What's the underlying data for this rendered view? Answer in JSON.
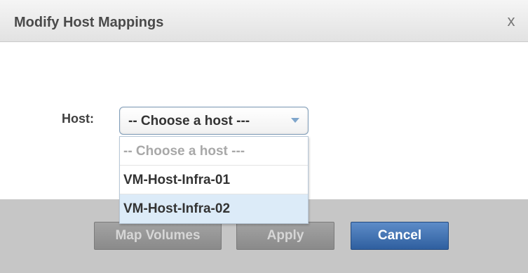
{
  "dialog": {
    "title": "Modify Host Mappings",
    "close_label": "x"
  },
  "host": {
    "label": "Host:",
    "selected_value": "-- Choose a host ---",
    "options": [
      {
        "label": "-- Choose a host ---",
        "placeholder": true
      },
      {
        "label": "VM-Host-Infra-01"
      },
      {
        "label": "VM-Host-Infra-02",
        "highlighted": true
      }
    ]
  },
  "buttons": {
    "map_volumes": {
      "label": "Map Volumes",
      "enabled": false
    },
    "apply": {
      "label": "Apply",
      "enabled": false
    },
    "cancel": {
      "label": "Cancel",
      "enabled": true
    }
  },
  "colors": {
    "primary_button": "#3d6fb0",
    "disabled_button": "#959595",
    "highlight": "#dcebf8",
    "footer": "#c6c6c6"
  }
}
